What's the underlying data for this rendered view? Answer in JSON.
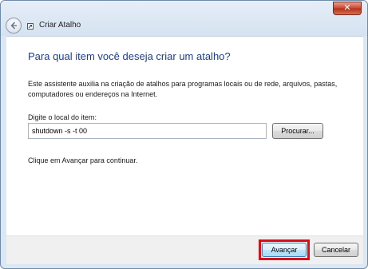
{
  "window": {
    "title": "Criar Atalho",
    "close_glyph": "✕"
  },
  "icons": {
    "back": "back-arrow-icon",
    "shortcut": "shortcut-icon",
    "close": "close-icon"
  },
  "main": {
    "heading": "Para qual item você deseja criar um atalho?",
    "description": "Este assistente auxilia na criação de atalhos para programas locais ou de rede, arquivos, pastas, computadores ou endereços na Internet.",
    "field_label": "Digite o local do item:",
    "location_value": "shutdown -s -t 00",
    "browse_label": "Procurar...",
    "hint": "Clique em Avançar para continuar."
  },
  "footer": {
    "next_label": "Avançar",
    "cancel_label": "Cancelar"
  },
  "colors": {
    "heading": "#1e3e8a",
    "highlight": "#d8101c",
    "close_button": "#c7452c",
    "frame": "#dbe7f3"
  }
}
